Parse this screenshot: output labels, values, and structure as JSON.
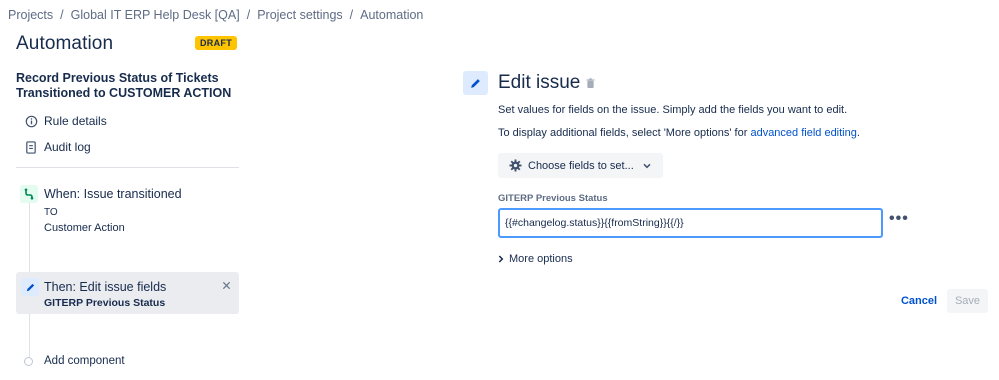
{
  "breadcrumb": {
    "items": [
      "Projects",
      "Global IT ERP Help Desk [QA]",
      "Project settings",
      "Automation"
    ],
    "separator": "/"
  },
  "header": {
    "title": "Automation",
    "badge": "DRAFT"
  },
  "sidebar": {
    "rule_name": "Record Previous Status of Tickets Transitioned to CUSTOMER ACTION",
    "links": [
      {
        "label": "Rule details",
        "icon": "info-icon"
      },
      {
        "label": "Audit log",
        "icon": "document-icon"
      }
    ],
    "trigger": {
      "title": "When: Issue transitioned",
      "sub_label": "TO",
      "sub_value": "Customer Action",
      "icon": "transition-icon",
      "color": "#36b37e"
    },
    "action": {
      "title": "Then: Edit issue fields",
      "subtitle": "GITERP Previous Status",
      "icon": "pencil-icon",
      "close_icon": "close-icon"
    },
    "add_component": "Add component"
  },
  "panel": {
    "title": "Edit issue",
    "description1": "Set values for fields on the issue. Simply add the fields you want to edit.",
    "description2_prefix": "To display additional fields, select 'More options' for ",
    "description2_link": "advanced field editing",
    "description2_suffix": ".",
    "choose_fields_label": "Choose fields to set...",
    "field": {
      "label": "GITERP Previous Status",
      "value": "{{#changelog.status}}{{fromString}}{{/}}"
    },
    "more_options": "More options",
    "cancel_label": "Cancel",
    "save_label": "Save"
  },
  "colors": {
    "accent": "#0052cc",
    "badge": "#ffc400",
    "focus_border": "#4c9aff"
  }
}
